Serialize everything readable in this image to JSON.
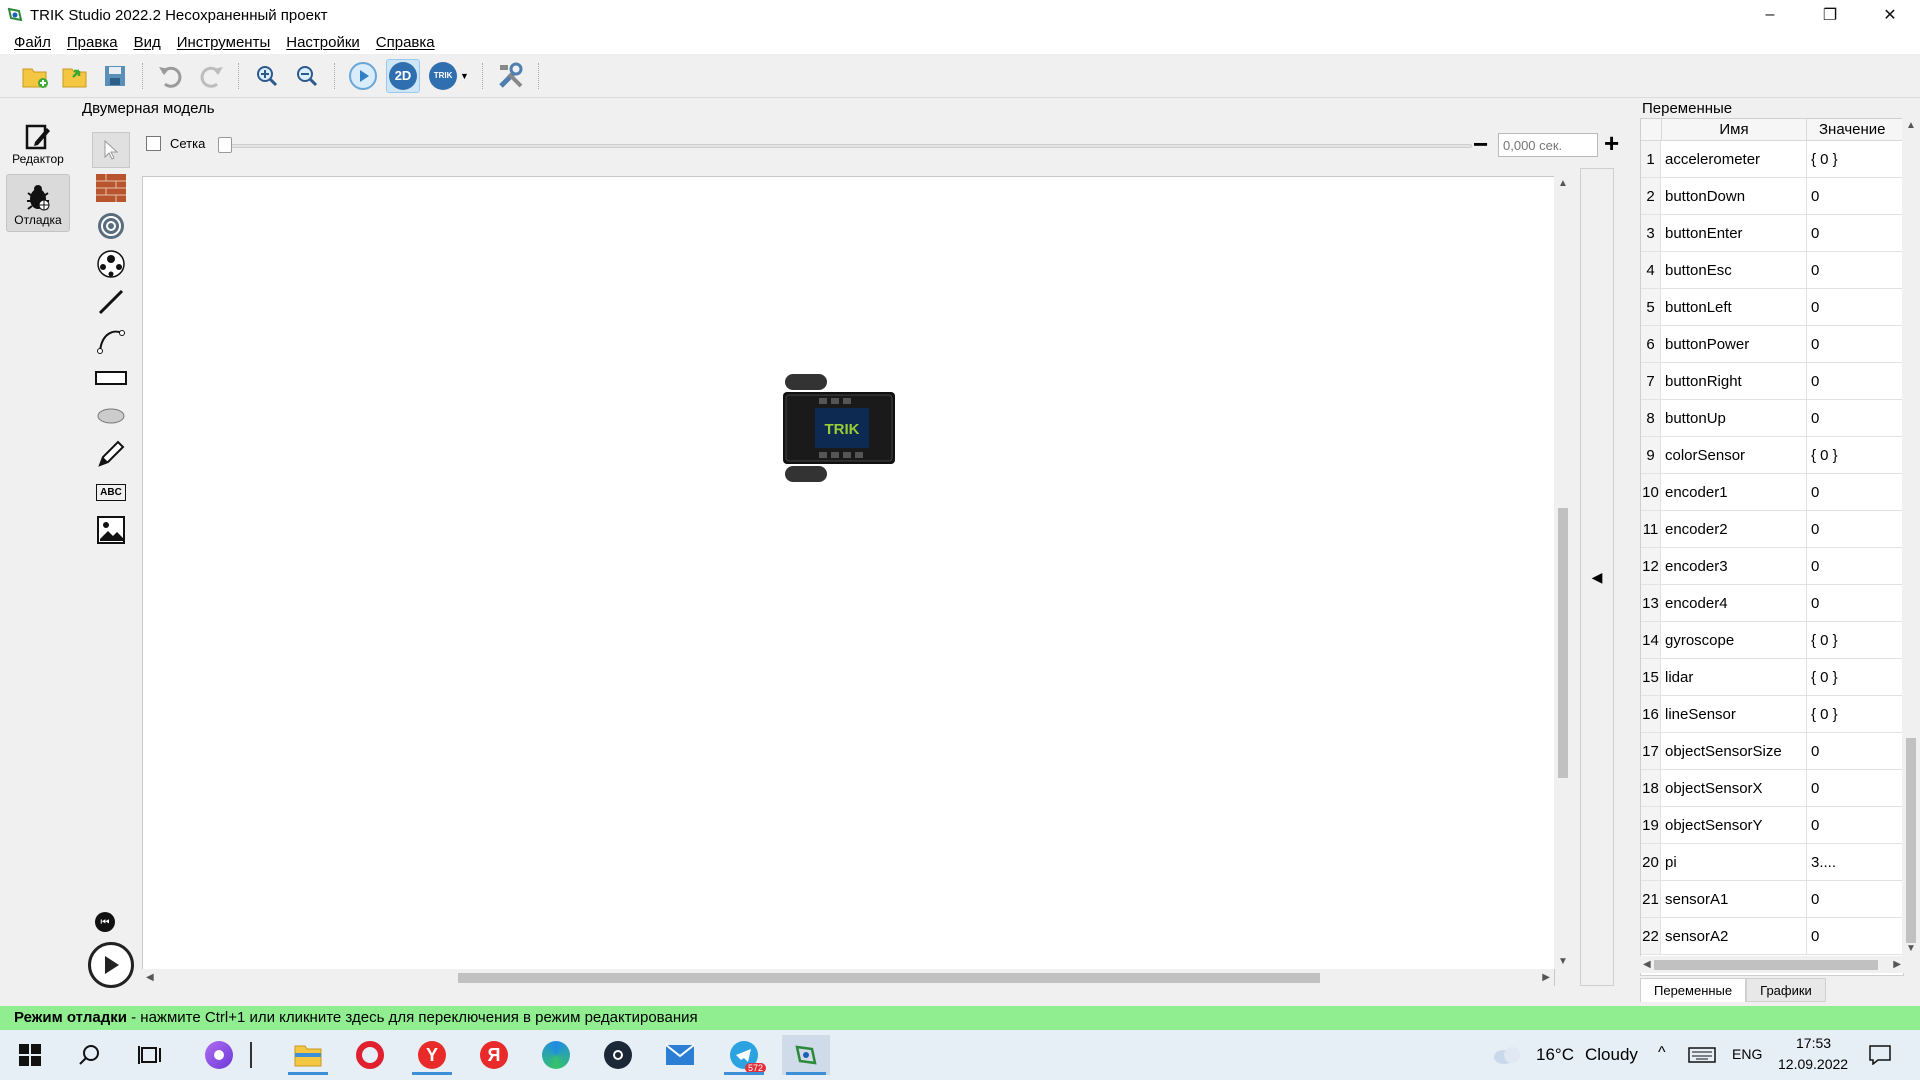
{
  "window": {
    "title": "TRIK Studio 2022.2 Несохраненный проект",
    "controls": {
      "minimize": "–",
      "maximize": "❐",
      "close": "✕"
    }
  },
  "menu": [
    "Файл",
    "Правка",
    "Вид",
    "Инструменты",
    "Настройки",
    "Справка"
  ],
  "toolbar": {
    "icons": [
      "new-project-icon",
      "open-folder-icon",
      "save-icon",
      "undo-icon",
      "redo-icon",
      "zoom-in-icon",
      "zoom-out-icon",
      "run-icon",
      "2d-model-icon",
      "trik-robot-icon",
      "settings-tools-icon"
    ],
    "twod_label": "2D",
    "trik_label": "TRIK"
  },
  "modes": {
    "editor": "Редактор",
    "debug": "Отладка"
  },
  "model": {
    "title": "Двумерная модель",
    "grid_label": "Сетка",
    "time_placeholder": "0,000 сек.",
    "robot_label": "TRIK"
  },
  "palette": [
    "cursor-icon",
    "wall-icon",
    "skittle-icon",
    "ball-icon",
    "line-icon",
    "bezier-icon",
    "rectangle-icon",
    "ellipse-icon",
    "pencil-icon",
    "text-icon",
    "image-icon"
  ],
  "palette_text_label": "ABC",
  "variables": {
    "title": "Переменные",
    "col_name": "Имя",
    "col_value": "Значение",
    "rows": [
      {
        "n": "1",
        "name": "accelerometer",
        "value": "{ 0 }"
      },
      {
        "n": "2",
        "name": "buttonDown",
        "value": "0"
      },
      {
        "n": "3",
        "name": "buttonEnter",
        "value": "0"
      },
      {
        "n": "4",
        "name": "buttonEsc",
        "value": "0"
      },
      {
        "n": "5",
        "name": "buttonLeft",
        "value": "0"
      },
      {
        "n": "6",
        "name": "buttonPower",
        "value": "0"
      },
      {
        "n": "7",
        "name": "buttonRight",
        "value": "0"
      },
      {
        "n": "8",
        "name": "buttonUp",
        "value": "0"
      },
      {
        "n": "9",
        "name": "colorSensor",
        "value": "{ 0 }"
      },
      {
        "n": "10",
        "name": "encoder1",
        "value": "0"
      },
      {
        "n": "11",
        "name": "encoder2",
        "value": "0"
      },
      {
        "n": "12",
        "name": "encoder3",
        "value": "0"
      },
      {
        "n": "13",
        "name": "encoder4",
        "value": "0"
      },
      {
        "n": "14",
        "name": "gyroscope",
        "value": "{ 0 }"
      },
      {
        "n": "15",
        "name": "lidar",
        "value": "{ 0 }"
      },
      {
        "n": "16",
        "name": "lineSensor",
        "value": "{ 0 }"
      },
      {
        "n": "17",
        "name": "objectSensorSize",
        "value": "0"
      },
      {
        "n": "18",
        "name": "objectSensorX",
        "value": "0"
      },
      {
        "n": "19",
        "name": "objectSensorY",
        "value": "0"
      },
      {
        "n": "20",
        "name": "pi",
        "value": "3...."
      },
      {
        "n": "21",
        "name": "sensorA1",
        "value": "0"
      },
      {
        "n": "22",
        "name": "sensorA2",
        "value": "0"
      }
    ],
    "tabs": [
      "Переменные",
      "Графики"
    ]
  },
  "status": {
    "bold": "Режим отладки",
    "text": " - нажмите Ctrl+1 или кликните здесь для переключения в режим редактирования"
  },
  "taskbar": {
    "telegram_badge": "572",
    "weather_temp": "16°C",
    "weather_text": "Cloudy",
    "lang": "ENG",
    "time": "17:53",
    "date": "12.09.2022"
  }
}
